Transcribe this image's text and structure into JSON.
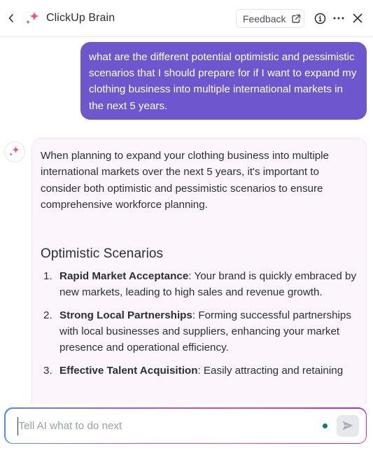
{
  "header": {
    "title": "ClickUp Brain",
    "feedback_label": "Feedback",
    "icons": {
      "back": "chevron-left-icon",
      "brand": "sparkle-icon",
      "external_link": "external-link-icon",
      "info": "info-icon",
      "more": "more-horizontal-icon",
      "close": "close-icon"
    }
  },
  "colors": {
    "user_bubble": "#6e56cf",
    "ai_card_bg": "#fcf5fb",
    "status_dot": "#0e7c6b",
    "brand_pink": "#f5477b",
    "brand_blue": "#7b6cf6"
  },
  "conversation": {
    "user_message": "what are the different potential optimistic and pessimistic scenarios that I should prepare for if I want to expand my clothing business into multiple international markets in the next 5 years.",
    "ai_response": {
      "intro": "When planning to expand your clothing business into multiple international markets over the next 5 years, it's important to consider both optimistic and pessimistic scenarios to ensure comprehensive workforce planning.",
      "section_title": "Optimistic Scenarios",
      "items": [
        {
          "number": "1.",
          "title": "Rapid Market Acceptance",
          "text": ": Your brand is quickly em­braced by new markets, leading to high sales and revenue growth."
        },
        {
          "number": "2.",
          "title": "Strong Local Partnerships",
          "text": ": Forming successful partner­ships with local businesses and suppliers, enhancing your market presence and operational efficiency."
        },
        {
          "number": "3.",
          "title": "Effective Talent Acquisition",
          "text": ": Easily attracting and retain­ing"
        }
      ]
    }
  },
  "composer": {
    "placeholder": "Tell AI what to do next",
    "value": ""
  }
}
